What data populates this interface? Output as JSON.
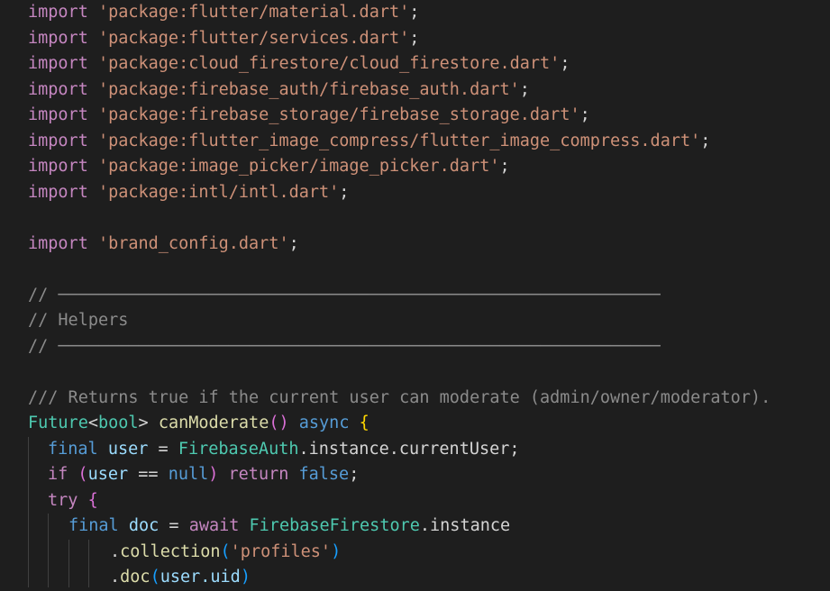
{
  "editor": {
    "imports": [
      {
        "kw": "import",
        "str": "'package:flutter/material.dart'",
        "end": ";"
      },
      {
        "kw": "import",
        "str": "'package:flutter/services.dart'",
        "end": ";"
      },
      {
        "kw": "import",
        "str": "'package:cloud_firestore/cloud_firestore.dart'",
        "end": ";"
      },
      {
        "kw": "import",
        "str": "'package:firebase_auth/firebase_auth.dart'",
        "end": ";"
      },
      {
        "kw": "import",
        "str": "'package:firebase_storage/firebase_storage.dart'",
        "end": ";"
      },
      {
        "kw": "import",
        "str": "'package:flutter_image_compress/flutter_image_compress.dart'",
        "end": ";"
      },
      {
        "kw": "import",
        "str": "'package:image_picker/image_picker.dart'",
        "end": ";"
      },
      {
        "kw": "import",
        "str": "'package:intl/intl.dart'",
        "end": ";"
      }
    ],
    "local_import": {
      "kw": "import",
      "str": "'brand_config.dart'",
      "end": ";"
    },
    "section_rule": "// ────────────────────────────────────────────────────────────",
    "section_title": "// Helpers",
    "doc_comment": "/// Returns true if the current user can moderate (admin/owner/moderator).",
    "signature": {
      "type": "Future",
      "lt": "<",
      "generic": "bool",
      "gt": ">",
      "space": " ",
      "fn_name": "canModerate",
      "parens": "()",
      "async_kw": "async",
      "open_brace": "{"
    },
    "line_user": {
      "final_kw": "final",
      "var_name": "user",
      "eq": "=",
      "class_name": "FirebaseAuth",
      "rest": ".instance.currentUser;"
    },
    "line_if": {
      "if_kw": "if",
      "open": "(",
      "var_name": "user",
      "op": "==",
      "null_kw": "null",
      "close": ")",
      "return_kw": "return",
      "false_kw": "false",
      "end": ";"
    },
    "line_try": {
      "try_kw": "try",
      "open_brace": "{"
    },
    "line_doc": {
      "final_kw": "final",
      "var_name": "doc",
      "eq": "=",
      "await_kw": "await",
      "class_name": "FirebaseFirestore",
      "rest": ".instance"
    },
    "line_collection": {
      "dot": ".",
      "method": "collection",
      "open": "(",
      "arg": "'profiles'",
      "close": ")"
    },
    "line_docuid": {
      "dot": ".",
      "method": "doc",
      "open": "(",
      "arg": "user.uid",
      "close": ")"
    }
  }
}
